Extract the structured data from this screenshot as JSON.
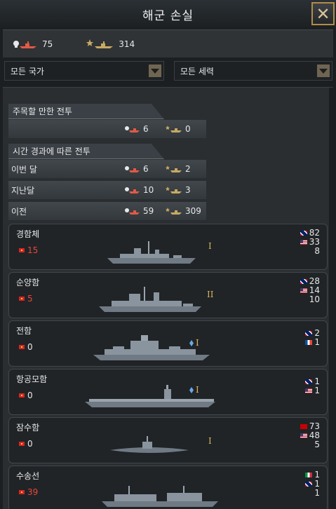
{
  "window": {
    "title": "해군 손실"
  },
  "summary": {
    "own_losses": "75",
    "enemy_losses": "314"
  },
  "filters": {
    "country": "모든 국가",
    "faction": "모든 세력"
  },
  "notable": {
    "header": "주목할 만한 전투",
    "own": "6",
    "enemy": "0"
  },
  "over_time": {
    "header": "시간 경과에 따른 전투",
    "rows": [
      {
        "label": "이번 달",
        "own": "6",
        "enemy": "2"
      },
      {
        "label": "지난달",
        "own": "10",
        "enemy": "3"
      },
      {
        "label": "이전",
        "own": "59",
        "enemy": "309"
      }
    ]
  },
  "ships": [
    {
      "name": "경함체",
      "own": "15",
      "tier": "I",
      "enemy": [
        {
          "flag": "uk",
          "value": "82"
        },
        {
          "flag": "us",
          "value": "33"
        },
        {
          "flag": "none",
          "value": "8"
        }
      ]
    },
    {
      "name": "순양함",
      "own": "5",
      "tier": "II",
      "enemy": [
        {
          "flag": "uk",
          "value": "28"
        },
        {
          "flag": "us",
          "value": "14"
        },
        {
          "flag": "none",
          "value": "10"
        }
      ]
    },
    {
      "name": "전함",
      "own": "0",
      "tier": "I",
      "enemy": [
        {
          "flag": "uk",
          "value": "2"
        },
        {
          "flag": "fr",
          "value": "1"
        }
      ]
    },
    {
      "name": "항공모함",
      "own": "0",
      "tier": "I",
      "enemy": [
        {
          "flag": "uk",
          "value": "1"
        },
        {
          "flag": "us",
          "value": "1"
        }
      ]
    },
    {
      "name": "잠수함",
      "own": "0",
      "tier": "I",
      "enemy": [
        {
          "flag": "su",
          "value": "73"
        },
        {
          "flag": "us",
          "value": "48"
        },
        {
          "flag": "none",
          "value": "5"
        }
      ]
    },
    {
      "name": "수송선",
      "own": "39",
      "tier": "",
      "enemy": [
        {
          "flag": "it",
          "value": "1"
        },
        {
          "flag": "uk",
          "value": "1"
        },
        {
          "flag": "none",
          "value": "1"
        }
      ]
    }
  ],
  "icons": {
    "own_loss": "red-sunk-ship-skull-icon",
    "enemy_loss": "gold-sunk-ship-star-icon",
    "close": "close-x-icon"
  },
  "colors": {
    "own_loss": "#e05a46",
    "enemy_loss": "#c7a964",
    "frame_gold": "#b28d4a"
  }
}
